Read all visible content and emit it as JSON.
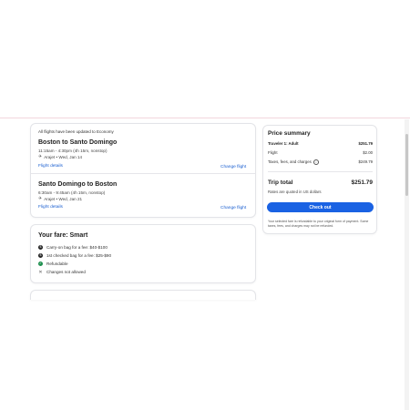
{
  "notice": "All flights have been updated to Economy",
  "flights": [
    {
      "route": "Boston to Santo Domingo",
      "times": "11:15am - 4:30pm (4h 15m, nonstop)",
      "airline": "Arajet • Wed, Jan 14",
      "details_link": "Flight details",
      "change_link": "Change flight"
    },
    {
      "route": "Santo Domingo to Boston",
      "times": "6:30am - 9:45am (4h 15m, nonstop)",
      "airline": "Arajet • Wed, Jan 21",
      "details_link": "Flight details",
      "change_link": "Change flight"
    }
  ],
  "fare": {
    "title": "Your fare: Smart",
    "items": [
      {
        "icon": "dollar-icon",
        "text": "Carry-on bag for a fee: $40-$100"
      },
      {
        "icon": "dollar-icon",
        "text": "1st checked bag for a fee: $25-$90"
      },
      {
        "icon": "check-icon",
        "text": "Refundable"
      },
      {
        "icon": "x-icon",
        "text": "Changes not allowed"
      }
    ]
  },
  "summary": {
    "title": "Price summary",
    "traveler_label": "Traveler 1: Adult",
    "traveler_value": "$251.79",
    "flight_label": "Flight",
    "flight_value": "$2.00",
    "taxes_label": "Taxes, fees, and charges",
    "taxes_value": "$249.79",
    "total_label": "Trip total",
    "total_value": "$251.79",
    "rates_note": "Rates are quoted in US dollars",
    "checkout_label": "Check out",
    "refund_note": "Your selected fare is refundable to your original form of payment. Some taxes, fees, and charges may not be refunded."
  },
  "colors": {
    "accent": "#1a62e3",
    "link": "#1a5fd0",
    "refundable": "#1e8f4e"
  }
}
